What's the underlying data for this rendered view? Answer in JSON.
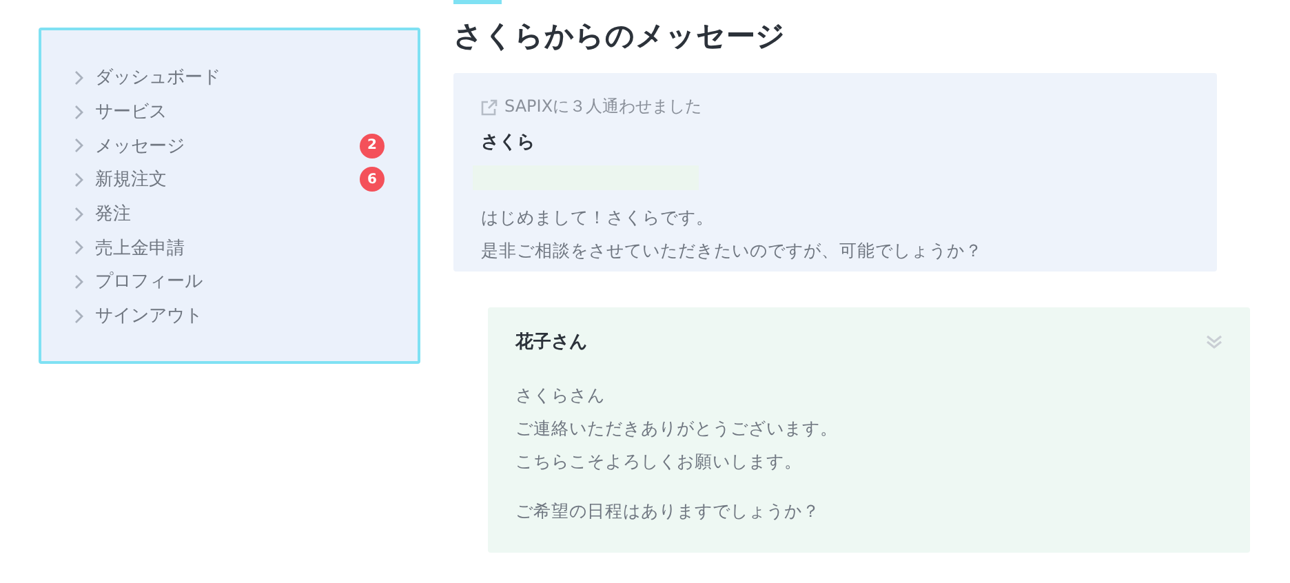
{
  "sidebar": {
    "items": [
      {
        "label": "ダッシュボード"
      },
      {
        "label": "サービス"
      },
      {
        "label": "メッセージ",
        "badge": "2"
      },
      {
        "label": "新規注文",
        "badge": "6"
      },
      {
        "label": "発注"
      },
      {
        "label": "売上金申請"
      },
      {
        "label": "プロフィール"
      },
      {
        "label": "サインアウト"
      }
    ]
  },
  "page_title": "さくらからのメッセージ",
  "messages": [
    {
      "kind": "incoming",
      "note": "SAPIXに３人通わせました",
      "sender": "さくら",
      "paragraphs": [
        [
          "はじめまして！さくらです。",
          "是非ご相談をさせていただきたいのですが、可能でしょうか？"
        ]
      ]
    },
    {
      "kind": "outgoing",
      "sender": "花子さん",
      "read": true,
      "paragraphs": [
        [
          "さくらさん",
          "ご連絡いただきありがとうございます。",
          "こちらこそよろしくお願いします。"
        ],
        [
          "ご希望の日程はありますでしょうか？"
        ]
      ]
    }
  ]
}
